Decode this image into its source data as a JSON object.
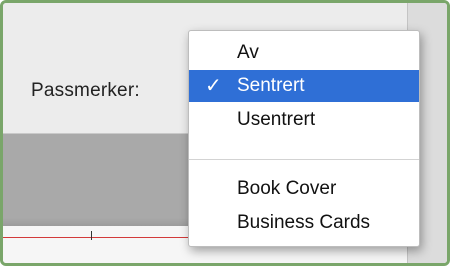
{
  "dialog": {
    "field_label": "Passmerker:",
    "dropdown": {
      "selected_value": "Sentrert",
      "options": [
        {
          "label": "Av",
          "selected": false
        },
        {
          "label": "Sentrert",
          "selected": true
        },
        {
          "label": "Usentrert",
          "selected": false
        },
        {
          "label": "Book Cover",
          "selected": false
        },
        {
          "label": "Business Cards",
          "selected": false
        }
      ]
    }
  },
  "icons": {
    "checkmark": "checkmark-icon"
  },
  "colors": {
    "frame_border": "#7aa66a",
    "selection": "#2f6fd6",
    "red_guide": "#d23a3a"
  }
}
